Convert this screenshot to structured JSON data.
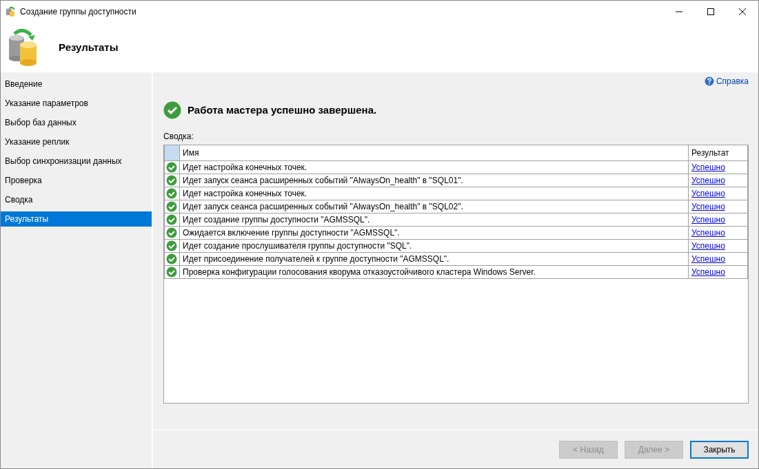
{
  "window": {
    "title": "Создание группы доступности"
  },
  "header": {
    "title": "Результаты"
  },
  "sidebar": {
    "items": [
      {
        "label": "Введение",
        "selected": false
      },
      {
        "label": "Указание параметров",
        "selected": false
      },
      {
        "label": "Выбор баз данных",
        "selected": false
      },
      {
        "label": "Указание реплик",
        "selected": false
      },
      {
        "label": "Выбор синхронизации данных",
        "selected": false
      },
      {
        "label": "Проверка",
        "selected": false
      },
      {
        "label": "Сводка",
        "selected": false
      },
      {
        "label": "Результаты",
        "selected": true
      }
    ]
  },
  "help_link": "Справка",
  "status_message": "Работа мастера успешно завершена.",
  "summary_label": "Сводка:",
  "table": {
    "columns": [
      "Имя",
      "Результат"
    ],
    "rows": [
      {
        "name": "Идет настройка конечных точек.",
        "result": "Успешно"
      },
      {
        "name": "Идет запуск сеанса расширенных событий \"AlwaysOn_health\" в \"SQL01\".",
        "result": "Успешно"
      },
      {
        "name": "Идет настройка конечных точек.",
        "result": "Успешно"
      },
      {
        "name": "Идет запуск сеанса расширенных событий \"AlwaysOn_health\" в \"SQL02\".",
        "result": "Успешно"
      },
      {
        "name": "Идет создание группы доступности \"AGMSSQL\".",
        "result": "Успешно"
      },
      {
        "name": "Ожидается включение группы доступности \"AGMSSQL\".",
        "result": "Успешно"
      },
      {
        "name": "Идет создание прослушивателя группы доступности \"SQL\".",
        "result": "Успешно"
      },
      {
        "name": "Идет присоединение получателей к группе доступности \"AGMSSQL\".",
        "result": "Успешно"
      },
      {
        "name": "Проверка конфигурации голосования кворума отказоустойчивого кластера Windows Server.",
        "result": "Успешно"
      }
    ]
  },
  "buttons": [
    {
      "label": "< Назад",
      "disabled": true,
      "default": false
    },
    {
      "label": "Далее >",
      "disabled": true,
      "default": false
    },
    {
      "label": "Закрыть",
      "disabled": false,
      "default": true
    }
  ]
}
